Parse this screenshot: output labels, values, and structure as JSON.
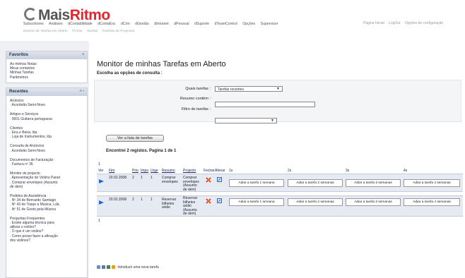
{
  "brand": {
    "part1": "Mais",
    "part2": "Ritmo"
  },
  "topnav": [
    "Subscritores",
    "Análises",
    "dContabilidade",
    "dContaEsc",
    "dCrm",
    "dGestão",
    "dIntranet",
    "dPessoal",
    "dSuporte",
    "dTeamControl",
    "Opções",
    "Supervisor"
  ],
  "subnav": [
    "Monitor de Tarefas em Aberto",
    "Fichas",
    "Tarefas",
    "Portfolio de Projectos"
  ],
  "toplinks": [
    "Página Inicial",
    "LogOut",
    "Opções de configuração"
  ],
  "favoritos": {
    "title": "Favoritos",
    "ctl": "«",
    "items": [
      "As minhas Notas",
      "Meus contactos",
      "Minhas Tarefas",
      "Parâmetros"
    ]
  },
  "recentes": {
    "title": "Recentes",
    "ctl": "‹‹ ›",
    "groups": [
      {
        "title": "Arúncios",
        "lines": [
          ". Acordeão Semi-Novo"
        ]
      },
      {
        "title": "Artigos e Serviços",
        "lines": [
          ". 0001 Guitarra portuguesa"
        ]
      },
      {
        "title": "Clientes",
        "lines": [
          ". Eira e Beira, lda",
          ". Loja de Instrumentos, lda"
        ]
      },
      {
        "title": "Consulta de Anúncios",
        "lines": [
          ". Acordeão Semi-Novo"
        ]
      },
      {
        "title": "Documentos de Facturação",
        "lines": [
          ". Factura nº 36"
        ]
      },
      {
        "title": "Monitor de projecto",
        "lines": [
          ". Apresentação do Violino Panet",
          ". Comprar envelopes (Assunto",
          "de dem)"
        ]
      },
      {
        "title": "Pedidos de Assistência",
        "lines": [
          ". Nº 34 de Bernardo Santiago",
          ". Nº 43 de Toque a Música, Lda.",
          ". Nº 51 de Gosto pela Música"
        ]
      },
      {
        "title": "Perguntas Frequentes",
        "lines": [
          ". Existe alguma técnica para",
          "utilizar o violino?",
          ". O que é um violino?",
          ". Como posso fazer a afinação",
          "dos violinos?"
        ]
      }
    ]
  },
  "page": {
    "title": "Monitor de minhas Tarefas em Aberto",
    "hint": "Escolha as opções de consulta :"
  },
  "form": {
    "quais_label": "Quais tarefas :",
    "quais_value": "Tarefas recentes",
    "resumo_label": "Resumo contém :",
    "resumo_value": "",
    "filtro_label": "Filtro de tarefas :",
    "filtro_value": ""
  },
  "list_button": "Ver a lista de tarefas",
  "found_text": "Encontrei 2 registos. Pagina 1 de 1",
  "table": {
    "page_top": "1",
    "page_bottom": "1",
    "headers": {
      "ver": "Ver",
      "fim": "Fim",
      "prio": "Prio",
      "impo": "Impo",
      "urge": "Urge",
      "resumo": "Resumo",
      "projecto": "Projecto",
      "fechar": "Fechar",
      "alterar": "Alterar",
      "w1": "1s",
      "w2": "2s",
      "w3": "3s",
      "w4": "4s"
    },
    "rows": [
      {
        "date": "20.02.2008",
        "prio": "2",
        "impo": "1",
        "urge": "1",
        "resumo": [
          "Comprar",
          "envelopes"
        ],
        "projecto": [
          "Comprar",
          "envelopes",
          "(Assunto",
          "de dem)"
        ]
      },
      {
        "date": "20.02.2008",
        "prio": "2",
        "impo": "1",
        "urge": "1",
        "resumo": [
          "Reservar",
          "bilhetes",
          "avião"
        ],
        "projecto": [
          "Reservar",
          "bilhetes",
          "avião",
          "(Assunto",
          "de dem)"
        ]
      }
    ],
    "week_buttons": [
      "Adiar a tarefa 1 semana",
      "Adiar a tarefa 2 semanas",
      "Adiar a tarefa 3 semanas",
      "Adiar a tarefa 4 semanas"
    ]
  },
  "footer_link": "Introduzir uma nova tarefa",
  "colors": {
    "brand_red": "#e0262e",
    "panel_header": "#c7d0dd",
    "row_bg": "#e6ebf3",
    "arrow": "#2b64c4"
  }
}
